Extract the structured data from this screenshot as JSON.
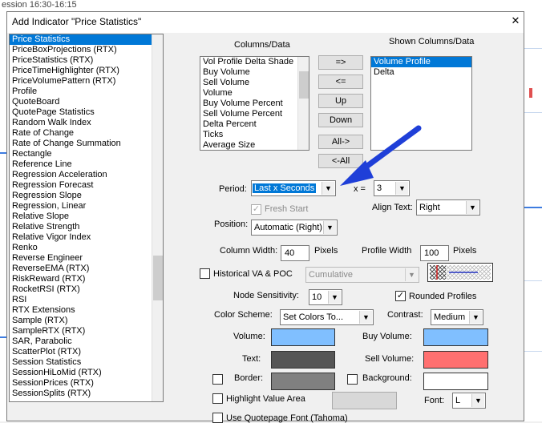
{
  "background": {
    "top_text": "ession 16:30-16:15"
  },
  "dialog": {
    "title": "Add Indicator \"Price Statistics\"",
    "close_glyph": "✕"
  },
  "indicator_list": [
    "Price Statistics",
    "PriceBoxProjections (RTX)",
    "PriceStatistics (RTX)",
    "PriceTimeHighlighter (RTX)",
    "PriceVolumePattern (RTX)",
    "Profile",
    "QuoteBoard",
    "QuotePage Statistics",
    "Random Walk Index",
    "Rate of Change",
    "Rate of Change Summation",
    "Rectangle",
    "Reference Line",
    "Regression Acceleration",
    "Regression Forecast",
    "Regression Slope",
    "Regression, Linear",
    "Relative Slope",
    "Relative Strength",
    "Relative Vigor Index",
    "Renko",
    "Reverse Engineer",
    "ReverseEMA (RTX)",
    "RiskReward (RTX)",
    "RocketRSI (RTX)",
    "RSI",
    "RTX Extensions",
    "Sample (RTX)",
    "SampleRTX (RTX)",
    "SAR, Parabolic",
    "ScatterPlot (RTX)",
    "Session Statistics",
    "SessionHiLoMid (RTX)",
    "SessionPrices (RTX)",
    "SessionSplits (RTX)"
  ],
  "columns": {
    "available_label": "Columns/Data",
    "available": [
      "Vol Profile Delta Shade",
      "Buy Volume",
      "Sell Volume",
      "Volume",
      "Buy Volume Percent",
      "Sell Volume Percent",
      "Delta Percent",
      "Ticks",
      "Average Size"
    ],
    "shown_label": "Shown Columns/Data",
    "shown": [
      "Volume Profile",
      "Delta"
    ],
    "buttons": {
      "add": "=>",
      "remove": "<=",
      "up": "Up",
      "down": "Down",
      "add_all": "All->",
      "remove_all": "<-All"
    }
  },
  "period": {
    "label": "Period:",
    "value": "Last x Seconds",
    "x_label": "x =",
    "x_value": "3",
    "fresh_start": "Fresh Start",
    "align_label": "Align Text:",
    "align_value": "Right",
    "position_label": "Position:",
    "position_value": "Automatic (Right)"
  },
  "widths": {
    "column_label": "Column Width:",
    "column_value": "40",
    "column_unit": "Pixels",
    "profile_label": "Profile Width",
    "profile_value": "100",
    "profile_unit": "Pixels"
  },
  "historical": {
    "label": "Historical VA & POC",
    "value": "Cumulative"
  },
  "node": {
    "label": "Node Sensitivity:",
    "value": "10",
    "rounded_label": "Rounded Profiles"
  },
  "color_scheme": {
    "label": "Color Scheme:",
    "value": "Set Colors To...",
    "contrast_label": "Contrast:",
    "contrast_value": "Medium"
  },
  "colors": {
    "volume_label": "Volume:",
    "volume_color": "#80bfff",
    "buy_volume_label": "Buy Volume:",
    "buy_volume_color": "#80bfff",
    "text_label": "Text:",
    "text_color": "#555555",
    "sell_volume_label": "Sell Volume:",
    "sell_volume_color": "#ff7070",
    "border_label": "Border:",
    "border_color": "#808080",
    "background_label": "Background:",
    "background_color": "#ffffff"
  },
  "highlight": {
    "label": "Highlight Value Area",
    "font_label": "Font:",
    "font_value": "L"
  },
  "quotepage_font": {
    "label": "Use Quotepage Font (Tahoma)"
  }
}
